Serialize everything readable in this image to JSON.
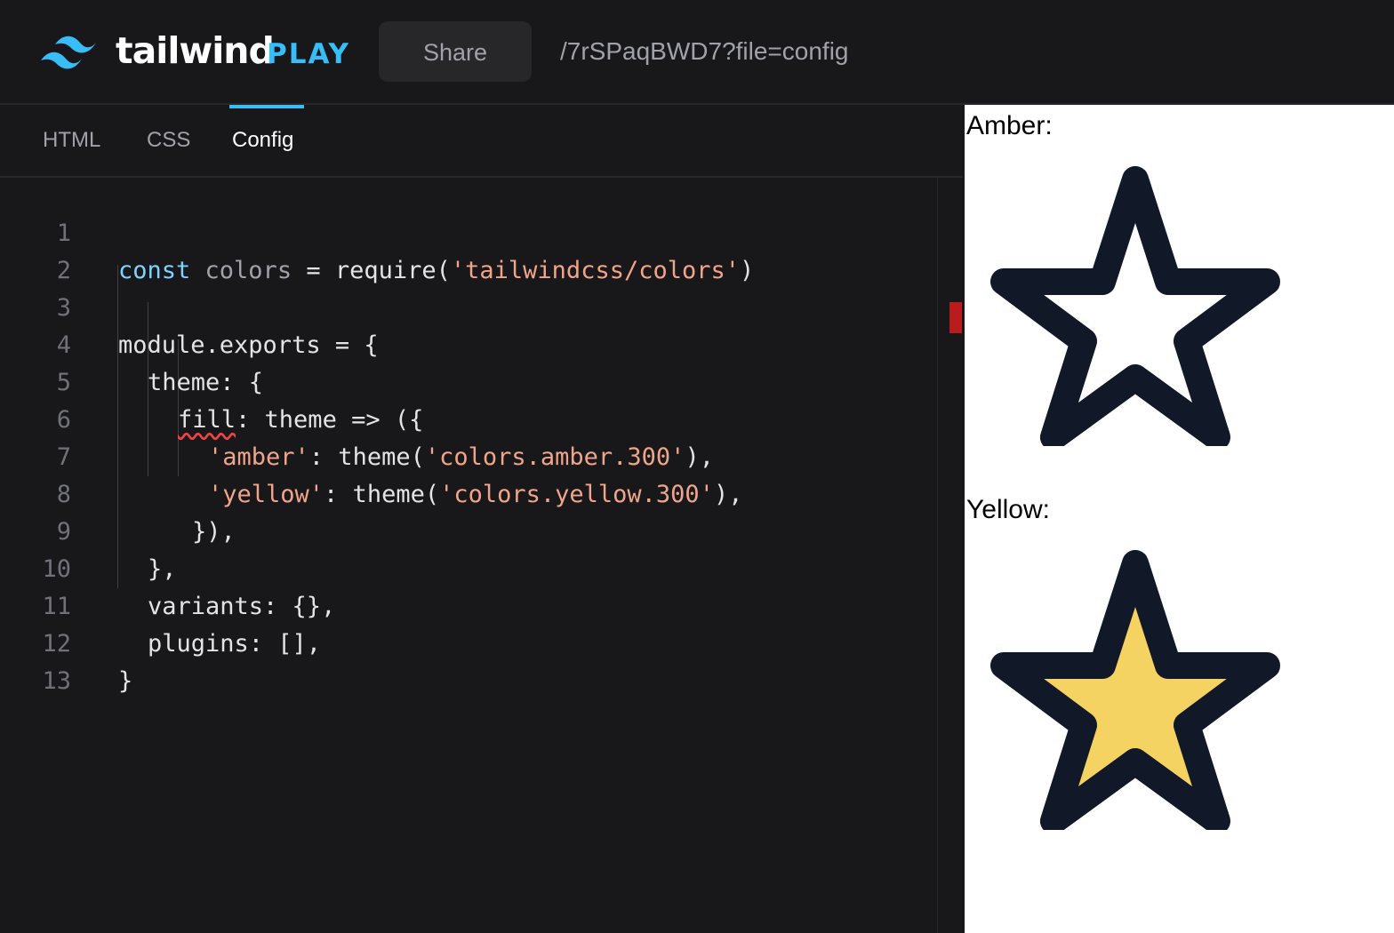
{
  "header": {
    "brand_name": "tailwind",
    "brand_suffix": "PLAY",
    "share_label": "Share",
    "url_path": "/7rSPaqBWD7?file=config"
  },
  "tabs": [
    {
      "label": "HTML",
      "active": false
    },
    {
      "label": "CSS",
      "active": false
    },
    {
      "label": "Config",
      "active": true
    }
  ],
  "editor": {
    "line_numbers": [
      "1",
      "2",
      "3",
      "4",
      "5",
      "6",
      "7",
      "8",
      "9",
      "10",
      "11",
      "12",
      "13"
    ],
    "code": {
      "l1_kw": "const",
      "l1_var": " colors",
      "l1_rest": " = require(",
      "l1_str": "'tailwindcss/colors'",
      "l1_end": ")",
      "l3": "module.exports = {",
      "l4": "theme: {",
      "l5_prop": "fill",
      "l5_rest": ": theme => ({",
      "l6_key": "'amber'",
      "l6_mid": ": theme(",
      "l6_str": "'colors.amber.300'",
      "l6_end": "),",
      "l7_key": "'yellow'",
      "l7_mid": ": theme(",
      "l7_str": "'colors.yellow.300'",
      "l7_end": "),",
      "l8": "}),",
      "l9": "},",
      "l10": "variants: {},",
      "l11": "plugins: [],",
      "l12": "}"
    }
  },
  "preview": {
    "items": [
      {
        "label": "Amber:",
        "fill": "#ffffff"
      },
      {
        "label": "Yellow:",
        "fill": "#f5d363"
      }
    ],
    "stroke": "#111827"
  },
  "colors": {
    "accent": "#38bdf8",
    "background": "#18181b",
    "error": "#b91c1c"
  }
}
